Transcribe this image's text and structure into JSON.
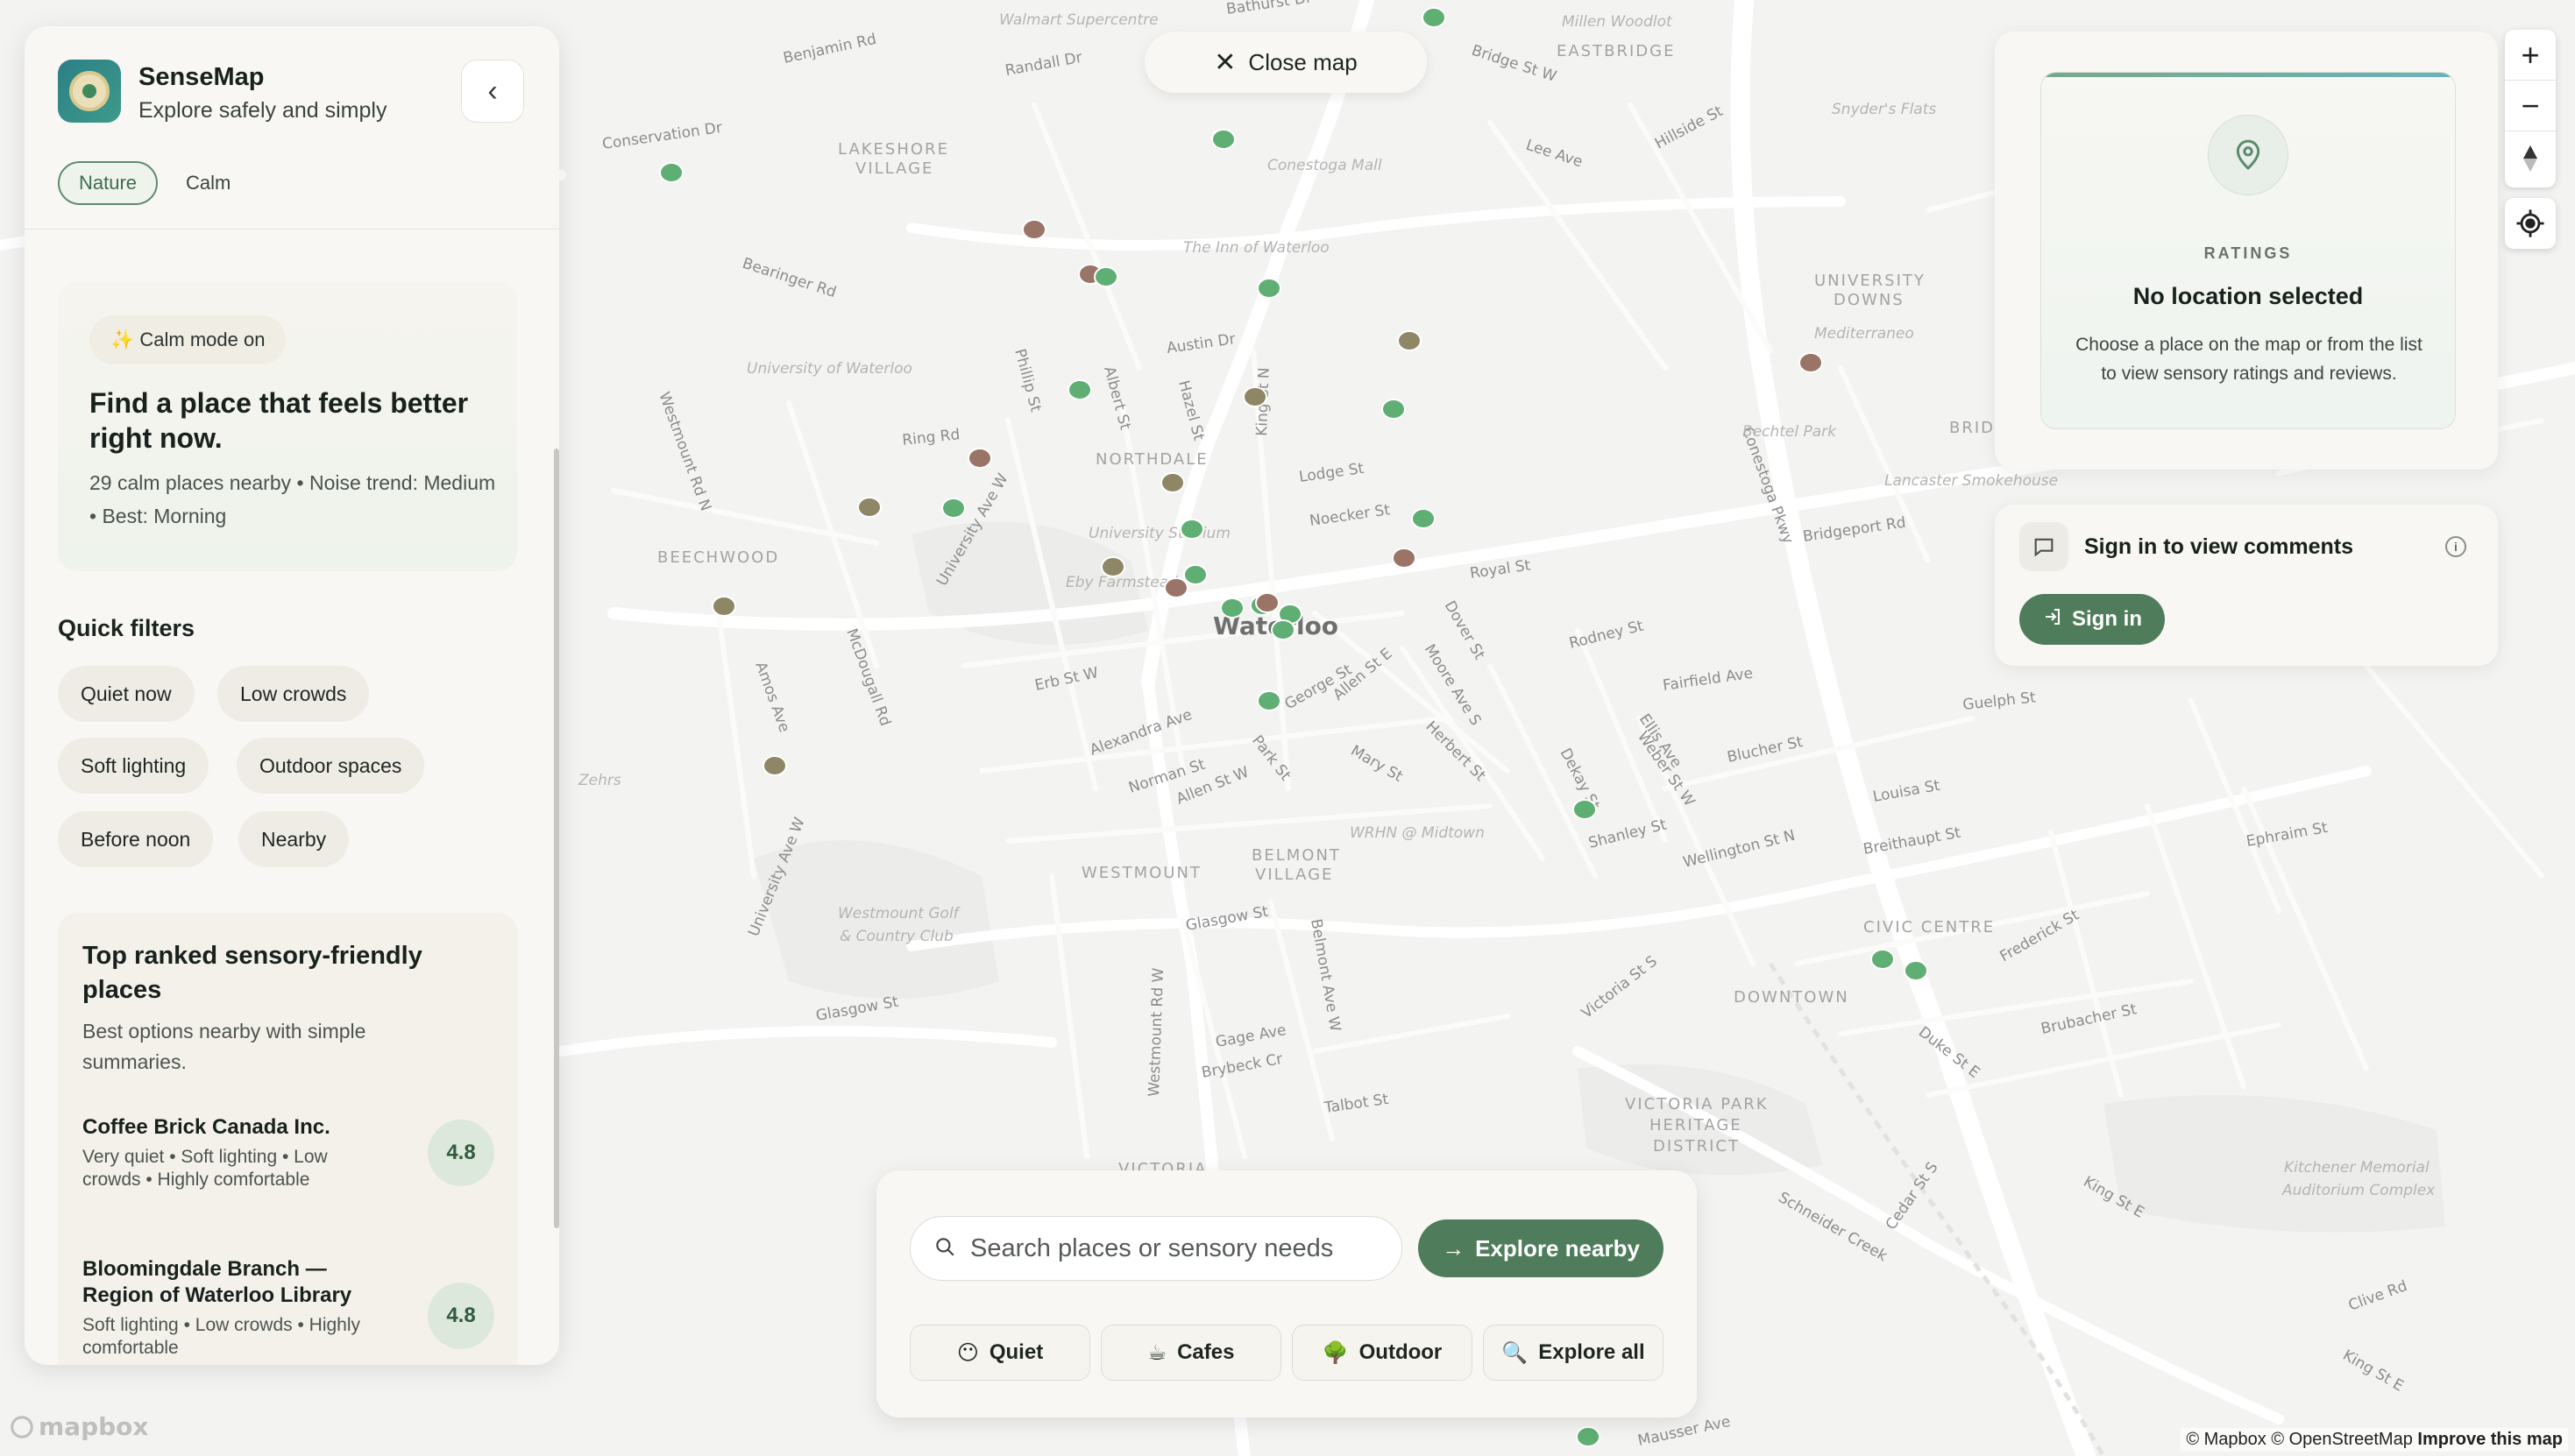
{
  "app": {
    "title": "SenseMap",
    "subtitle": "Explore safely and simply"
  },
  "header_tags": [
    "Nature",
    "Calm"
  ],
  "hero": {
    "badge_icon": "sparkle",
    "badge": "Calm mode on",
    "title": "Find a place that feels better right now.",
    "meta": "29 calm places nearby • Noise trend: Medium • Best: Morning"
  },
  "quick_filters": {
    "title": "Quick filters",
    "items": [
      "Quiet now",
      "Low crowds",
      "Soft lighting",
      "Outdoor spaces",
      "Before noon",
      "Nearby"
    ]
  },
  "top_ranked": {
    "title": "Top ranked sensory-friendly places",
    "subtitle": "Best options nearby with simple summaries.",
    "places": [
      {
        "name": "Coffee Brick Canada Inc.",
        "desc": "Very quiet • Soft lighting • Low crowds • Highly comfortable",
        "score": "4.8"
      },
      {
        "name": "Bloomingdale Branch — Region of Waterloo Library",
        "desc": "Soft lighting • Low crowds • Highly comfortable",
        "score": "4.8"
      }
    ]
  },
  "close_map": {
    "label": "Close map"
  },
  "ratings": {
    "label": "RATINGS",
    "title": "No location selected",
    "description": "Choose a place on the map or from the list to view sensory ratings and reviews."
  },
  "comments": {
    "title": "Sign in to view comments",
    "signin_label": "Sign in"
  },
  "map_controls": {
    "zoom_in": "+",
    "zoom_out": "−"
  },
  "search": {
    "placeholder": "Search places or sensory needs",
    "value": "",
    "explore_label": "Explore nearby",
    "categories": [
      {
        "icon": "😶",
        "label": "Quiet"
      },
      {
        "icon": "☕",
        "label": "Cafes"
      },
      {
        "icon": "🌳",
        "label": "Outdoor"
      },
      {
        "icon": "🔍",
        "label": "Explore all"
      }
    ]
  },
  "map": {
    "city": "Waterloo",
    "area_labels": [
      "LAKESHORE VILLAGE",
      "NORTHDALE",
      "BEECHWOOD",
      "WESTMOUNT",
      "BELMONT VILLAGE",
      "UNIVERSITY DOWNS",
      "EASTBRIDGE",
      "BRIDGEPORT",
      "CIVIC CENTRE",
      "DOWNTOWN",
      "VICTORIA PARK HERITAGE DISTRICT",
      "VICTORIA"
    ],
    "street_labels": [
      "Benjamin Rd",
      "Randall Dr",
      "Bathurst Dr",
      "Conservation Dr",
      "Bearinger Rd",
      "Austin Dr",
      "Ring Rd",
      "Phillip St",
      "Albert St",
      "Hazel St",
      "King St N",
      "Lodge St",
      "Noecker St",
      "Royal St",
      "Erb St W",
      "Alexandra Ave",
      "Norman St",
      "Allen St W",
      "George St",
      "Allen St E",
      "Park St",
      "Mary St",
      "Herbert St",
      "Moore Ave S",
      "Dover St",
      "Rodney St",
      "Fairfield Ave",
      "Bridgeport Rd",
      "Dekay St",
      "Weber St W",
      "Ellis Ave",
      "Blucher St",
      "Shanley St",
      "Wellington St N",
      "Breithaupt St",
      "Louisa St",
      "Guelph St",
      "Glasgow St",
      "Gage Ave",
      "Brybeck Cr",
      "Talbot St",
      "Belmont Ave W",
      "Westmount Rd W",
      "Victoria St S",
      "Duke St E",
      "Frederick St",
      "Brubacher St",
      "King St E",
      "Cedar St S",
      "Schneider Creek",
      "Mausser Ave",
      "Conestoga Pkwy",
      "Lee Ave",
      "Hillside St",
      "Bridge St W",
      "Amos Ave",
      "McDougall Rd",
      "University Ave W",
      "Westmount Rd N",
      "Ephraim St",
      "Clive Rd"
    ],
    "poi_labels": [
      "The Inn of Waterloo",
      "University of Waterloo",
      "Conestoga Mall",
      "Mediterraneo",
      "Bechtel Park",
      "Lancaster Smokehouse",
      "University Stadium",
      "Eby Farmstead",
      "WRHN @ Midtown",
      "Westmount Golf & Country Club",
      "Zehrs",
      "Kitchener Memorial Auditorium Complex",
      "Walmart Supercentre",
      "Millen Woodlot",
      "Snyder's Flats"
    ],
    "marker_colors": {
      "calm": "#5fae73",
      "moderate": "#8e8665",
      "busy": "#9a7466"
    }
  },
  "attribution": {
    "text": "© Mapbox © OpenStreetMap",
    "improve": "Improve this map",
    "logo": "mapbox"
  }
}
